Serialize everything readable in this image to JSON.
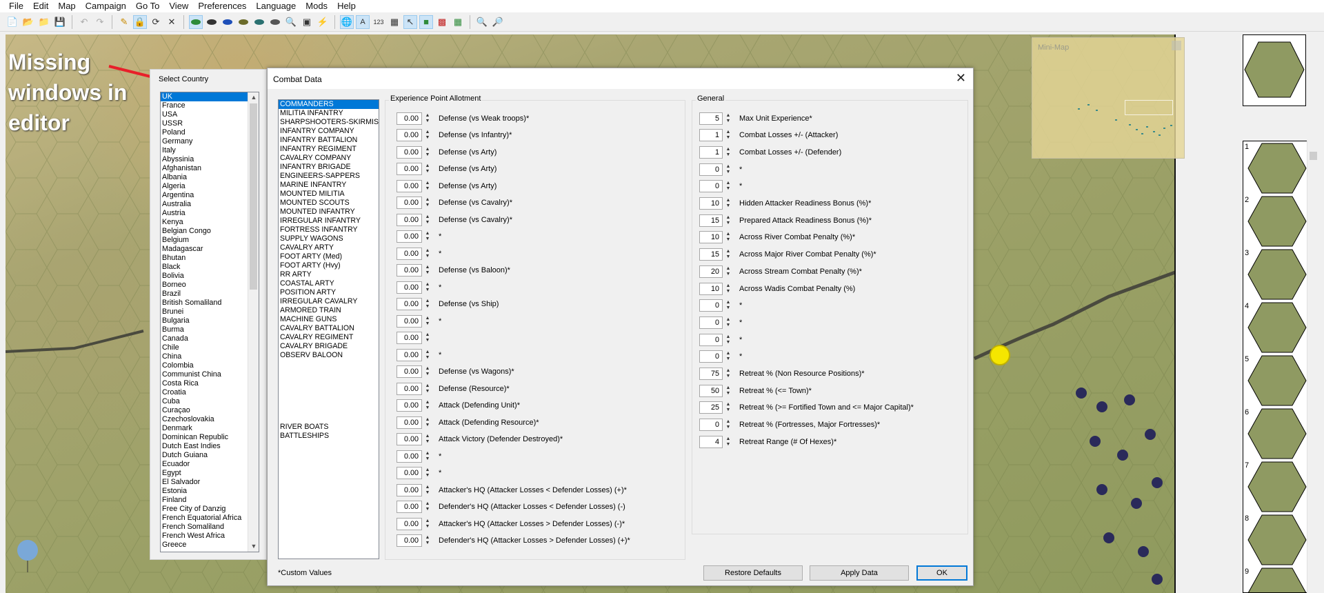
{
  "menu": [
    "File",
    "Edit",
    "Map",
    "Campaign",
    "Go To",
    "View",
    "Preferences",
    "Language",
    "Mods",
    "Help"
  ],
  "toolbar": [
    "new-icon",
    "open-icon",
    "open-folder-icon",
    "save-icon",
    "undo-icon",
    "redo-icon",
    "pencil-icon",
    "lock-icon",
    "select-icon",
    "delete-icon",
    "terrain-green-icon",
    "terrain-dark-icon",
    "terrain-blue-icon",
    "terrain-olive-icon",
    "terrain-teal-icon",
    "terrain-gray-icon",
    "zoom-icon",
    "unit-icon",
    "lightning-icon",
    "globe-icon",
    "text-icon",
    "numbers-icon",
    "grid-icon",
    "pointer-icon",
    "layers-icon",
    "palette-icon",
    "table-icon",
    "zoom-in-icon",
    "zoom-out-icon"
  ],
  "toolbar_numbers_label": "123",
  "annotation": {
    "line1": "Missing",
    "line2": "windows in",
    "line3": "editor",
    "arrow_color": "#e8202a"
  },
  "country_panel": {
    "title": "Select Country",
    "countries": [
      "UK",
      "France",
      "USA",
      "USSR",
      "Poland",
      "Germany",
      "Italy",
      "Abyssinia",
      "Afghanistan",
      "Albania",
      "Algeria",
      "Argentina",
      "Australia",
      "Austria",
      "Kenya",
      "Belgian Congo",
      "Belgium",
      "Madagascar",
      "Bhutan",
      "Black",
      "Bolivia",
      "Borneo",
      "Brazil",
      "British Somaliland",
      "Brunei",
      "Bulgaria",
      "Burma",
      "Canada",
      "Chile",
      "China",
      "Colombia",
      "Communist China",
      "Costa Rica",
      "Croatia",
      "Cuba",
      "Curaçao",
      "Czechoslovakia",
      "Denmark",
      "Dominican Republic",
      "Dutch East Indies",
      "Dutch Guiana",
      "Ecuador",
      "Egypt",
      "El Salvador",
      "Estonia",
      "Finland",
      "Free City of Danzig",
      "French Equatorial Africa",
      "French Somaliland",
      "French West Africa",
      "Greece"
    ],
    "selected": "UK"
  },
  "combat": {
    "title": "Combat Data",
    "units": [
      "COMMANDERS",
      "MILITIA INFANTRY",
      "SHARPSHOOTERS-SKIRMISHERS",
      "INFANTRY COMPANY",
      "INFANTRY BATTALION",
      "INFANTRY REGIMENT",
      "CAVALRY COMPANY",
      "INFANTRY BRIGADE",
      "ENGINEERS-SAPPERS",
      "MARINE INFANTRY",
      "MOUNTED MILITIA",
      "MOUNTED SCOUTS",
      "MOUNTED INFANTRY",
      "IRREGULAR INFANTRY",
      "FORTRESS INFANTRY",
      "SUPPLY WAGONS",
      "CAVALRY ARTY",
      "FOOT ARTY (Med)",
      "FOOT ARTY (Hvy)",
      "RR ARTY",
      "COASTAL ARTY",
      "POSITION ARTY",
      "IRREGULAR CAVALRY",
      "ARMORED TRAIN",
      "MACHINE GUNS",
      "CAVALRY BATTALION",
      "CAVALRY REGIMENT",
      "CAVALRY BRIGADE",
      "OBSERV BALOON",
      "",
      "",
      "",
      "",
      "",
      "",
      "",
      "RIVER BOATS",
      "BATTLESHIPS"
    ],
    "selected_unit": "COMMANDERS",
    "exp_title": "Experience Point Allotment",
    "exp_rows": [
      {
        "value": "0.00",
        "label": "Defense (vs Weak troops)*"
      },
      {
        "value": "0.00",
        "label": "Defense (vs Infantry)*"
      },
      {
        "value": "0.00",
        "label": "Defense (vs Arty)"
      },
      {
        "value": "0.00",
        "label": "Defense (vs Arty)"
      },
      {
        "value": "0.00",
        "label": "Defense (vs Arty)"
      },
      {
        "value": "0.00",
        "label": "Defense (vs Cavalry)*"
      },
      {
        "value": "0.00",
        "label": "Defense (vs Cavalry)*"
      },
      {
        "value": "0.00",
        "label": "*"
      },
      {
        "value": "0.00",
        "label": "*"
      },
      {
        "value": "0.00",
        "label": "Defense (vs Baloon)*"
      },
      {
        "value": "0.00",
        "label": "*"
      },
      {
        "value": "0.00",
        "label": "Defense (vs Ship)"
      },
      {
        "value": "0.00",
        "label": "*"
      },
      {
        "value": "0.00",
        "label": ""
      },
      {
        "value": "0.00",
        "label": "*"
      },
      {
        "value": "0.00",
        "label": "Defense (vs Wagons)*"
      },
      {
        "value": "0.00",
        "label": "Defense (Resource)*"
      },
      {
        "value": "0.00",
        "label": "Attack (Defending Unit)*"
      },
      {
        "value": "0.00",
        "label": "Attack (Defending Resource)*"
      },
      {
        "value": "0.00",
        "label": "Attack Victory (Defender Destroyed)*"
      },
      {
        "value": "0.00",
        "label": "*"
      },
      {
        "value": "0.00",
        "label": "*"
      },
      {
        "value": "0.00",
        "label": "Attacker's HQ (Attacker Losses < Defender Losses) (+)*"
      },
      {
        "value": "0.00",
        "label": "Defender's HQ (Attacker Losses < Defender Losses) (-)"
      },
      {
        "value": "0.00",
        "label": "Attacker's HQ (Attacker Losses > Defender Losses) (-)*"
      },
      {
        "value": "0.00",
        "label": "Defender's HQ (Attacker Losses > Defender Losses) (+)*"
      }
    ],
    "gen_title": "General",
    "gen_rows": [
      {
        "value": "5",
        "label": "Max Unit Experience*"
      },
      {
        "value": "1",
        "label": "Combat Losses +/- (Attacker)"
      },
      {
        "value": "1",
        "label": "Combat Losses +/- (Defender)"
      },
      {
        "value": "0",
        "label": "*"
      },
      {
        "value": "0",
        "label": "*"
      },
      {
        "value": "10",
        "label": "Hidden Attacker Readiness Bonus (%)*"
      },
      {
        "value": "15",
        "label": "Prepared Attack Readiness Bonus (%)*"
      },
      {
        "value": "10",
        "label": "Across River Combat Penalty (%)*"
      },
      {
        "value": "15",
        "label": "Across Major River Combat Penalty (%)*"
      },
      {
        "value": "20",
        "label": "Across Stream Combat Penalty (%)*"
      },
      {
        "value": "10",
        "label": "Across Wadis Combat Penalty (%)"
      },
      {
        "value": "0",
        "label": "*"
      },
      {
        "value": "0",
        "label": "*"
      },
      {
        "value": "0",
        "label": "*"
      },
      {
        "value": "0",
        "label": "*"
      },
      {
        "value": "75",
        "label": "Retreat % (Non Resource Positions)*"
      },
      {
        "value": "50",
        "label": "Retreat % (<= Town)*"
      },
      {
        "value": "25",
        "label": "Retreat % (>= Fortified Town and <= Major Capital)*"
      },
      {
        "value": "0",
        "label": "Retreat % (Fortresses, Major Fortresses)*"
      },
      {
        "value": "4",
        "label": "Retreat Range (# Of Hexes)*"
      }
    ],
    "custom_note": "*Custom Values",
    "buttons": {
      "restore": "Restore Defaults",
      "apply": "Apply Data",
      "ok": "OK"
    }
  },
  "minimap": {
    "title": "Mini-Map"
  },
  "palette": {
    "slots": [
      "1",
      "2",
      "3",
      "4",
      "5",
      "6",
      "7",
      "8",
      "9"
    ]
  },
  "colors": {
    "selection": "#0078d7",
    "terrain": "#9aa066",
    "hex_fill": "#8f9a62",
    "marker": "#f5e600"
  }
}
